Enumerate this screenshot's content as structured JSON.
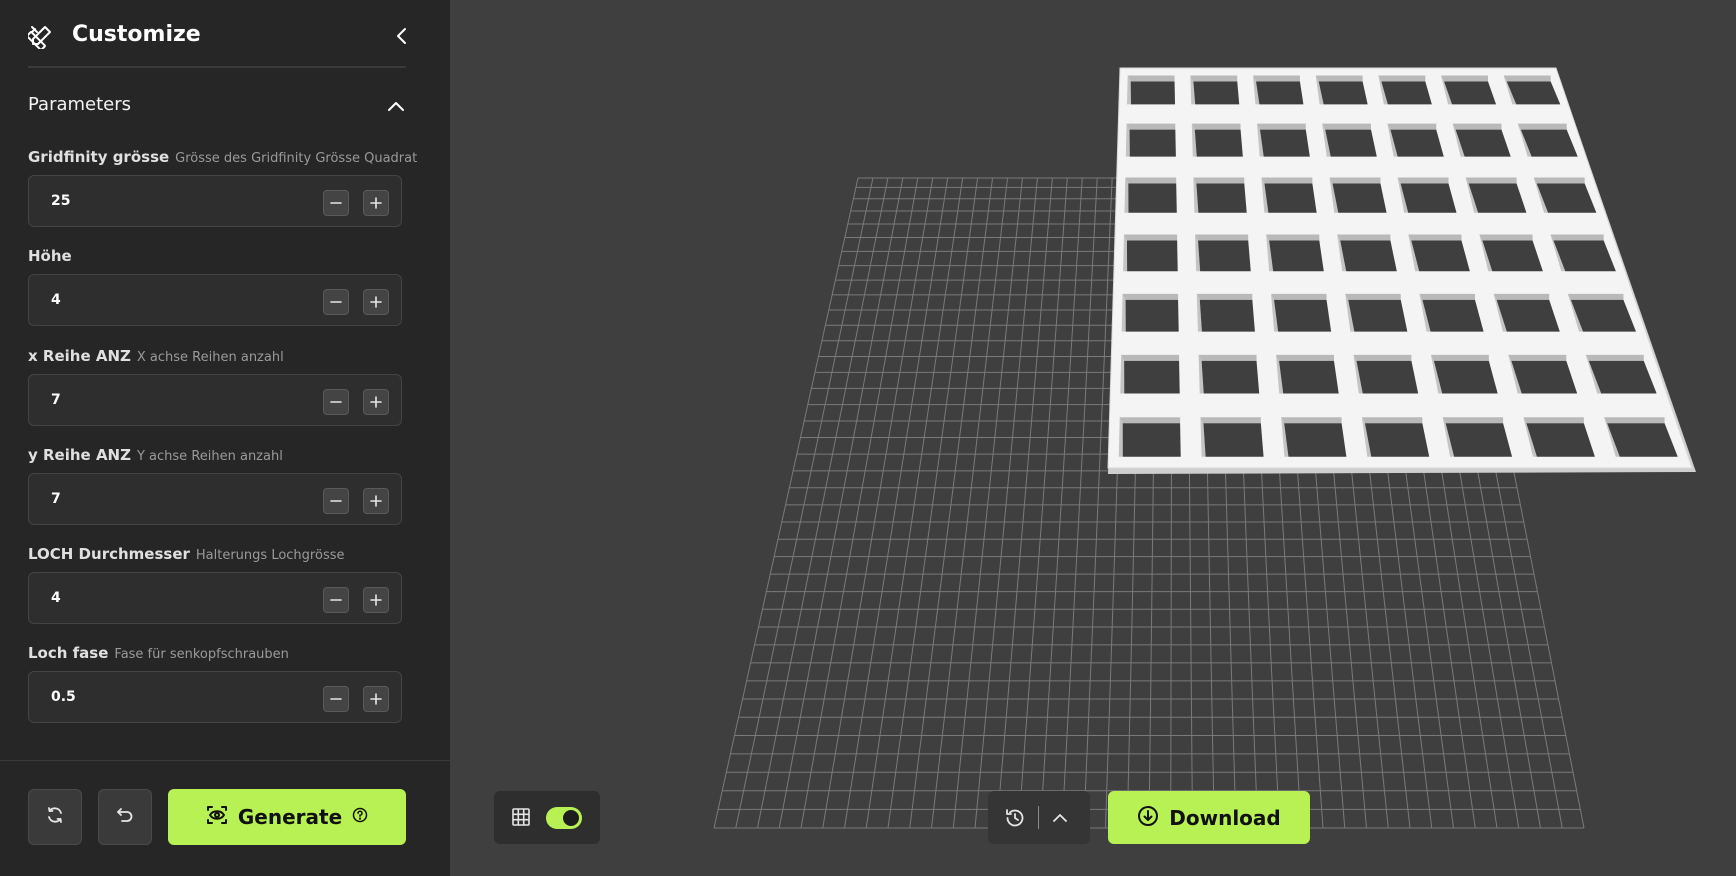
{
  "sidebar": {
    "title": "Customize",
    "icons": {
      "logo": "pencil-ruler-icon",
      "collapse": "chevron-left-icon"
    },
    "section": {
      "label": "Parameters",
      "icon": "chevron-up-icon"
    },
    "fields": [
      {
        "name": "Gridfinity grösse",
        "desc": "Grösse des Gridfinity Grösse Quadrat",
        "value": "25"
      },
      {
        "name": "Höhe",
        "desc": "",
        "value": "4"
      },
      {
        "name": "x Reihe ANZ",
        "desc": "X achse Reihen anzahl",
        "value": "7"
      },
      {
        "name": "y Reihe ANZ",
        "desc": "Y achse Reihen anzahl",
        "value": "7"
      },
      {
        "name": "LOCH Durchmesser",
        "desc": "Halterungs Lochgrösse",
        "value": "4"
      },
      {
        "name": "Loch fase",
        "desc": "Fase für senkopfschrauben",
        "value": "0.5"
      }
    ],
    "footer": {
      "reset_icon": "refresh-icon",
      "undo_icon": "undo-icon",
      "generate_label": "Generate",
      "generate_icon": "eye-scan-icon",
      "help_icon": "help-circle-icon"
    }
  },
  "viewport": {
    "grid_toggle_icon": "grid-icon",
    "grid_toggle_on": true,
    "history_icon": "history-icon",
    "expand_icon": "chevron-up-icon",
    "download_label": "Download",
    "download_icon": "download-circle-icon",
    "model": {
      "cols": 7,
      "rows": 7
    }
  },
  "colors": {
    "accent": "#b8f154",
    "sidebar_bg": "#262626",
    "viewport_bg": "#3f3f3f"
  }
}
